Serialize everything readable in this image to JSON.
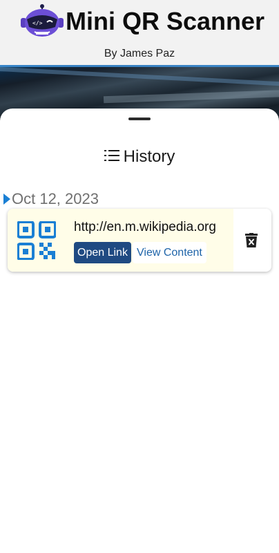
{
  "header": {
    "title": "Mini QR Scanner",
    "author": "By James Paz",
    "logo_icon": "robot-mascot-icon"
  },
  "history": {
    "heading": "History",
    "heading_icon": "list-icon",
    "groups": [
      {
        "date": "Oct 12, 2023",
        "items": [
          {
            "content": "http://en.m.wikipedia.org",
            "type_icon": "qr-code-icon",
            "open_label": "Open Link",
            "view_label": "View Content",
            "delete_icon": "delete-icon"
          }
        ]
      }
    ]
  },
  "colors": {
    "accent": "#1f4a82",
    "link": "#1d63a8",
    "qr_blue": "#1a7fd4",
    "card_highlight": "#fffde8"
  }
}
